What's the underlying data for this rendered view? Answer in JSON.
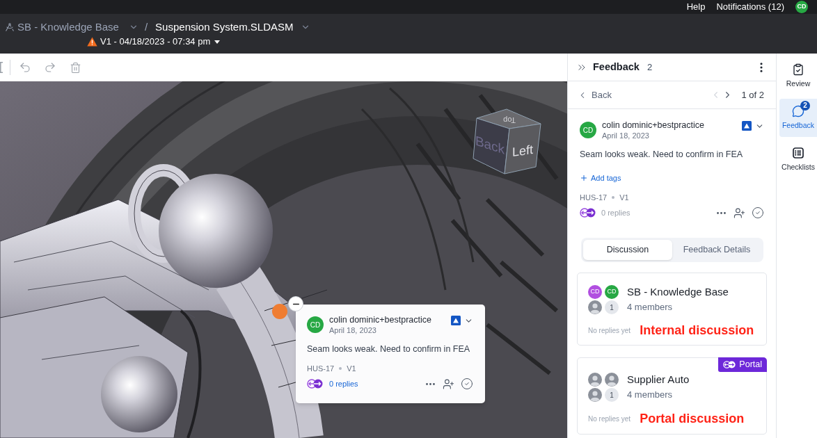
{
  "top_bar": {
    "links": [
      "Help",
      "Notifications (12)"
    ],
    "user_initials": "CD"
  },
  "header": {
    "project": "SB - Knowledge Base",
    "separator": "/",
    "file": "Suspension System.SLDASM",
    "version": "V1 - 04/18/2023 - 07:34 pm"
  },
  "viewport": {
    "view_cube": {
      "faces": [
        {
          "kind": "top",
          "label": "Top"
        },
        {
          "kind": "back",
          "label": "Back"
        },
        {
          "kind": "left",
          "label": "Left"
        }
      ]
    },
    "popup": {
      "initials": "CD",
      "author": "colin dominic+bestpractice",
      "date": "April 18, 2023",
      "text": "Seam looks weak. Need to confirm in FEA",
      "id": "HUS-17",
      "version": "V1",
      "replies": "0 replies"
    }
  },
  "feedback_panel": {
    "title": "Feedback",
    "count": "2",
    "back": "Back",
    "pager": {
      "text": "1 of 2",
      "prev_disabled": true,
      "next_disabled": false
    },
    "comment": {
      "initials": "CD",
      "author": "colin dominic+bestpractice",
      "date": "April 18, 2023",
      "text": "Seam looks weak. Need to confirm in FEA",
      "add_tags": "Add tags",
      "id": "HUS-17",
      "version": "V1",
      "replies": "0 replies"
    },
    "tabs": [
      {
        "label": "Discussion",
        "selected": true
      },
      {
        "label": "Feedback Details",
        "selected": false
      }
    ],
    "discussions": [
      {
        "name": "SB - Knowledge Base",
        "avatars": [
          {
            "kind": "initials",
            "text": "CD",
            "color": "#b14fe0"
          },
          {
            "kind": "initials",
            "text": "CD",
            "color": "#27a844"
          },
          {
            "kind": "photo"
          },
          {
            "kind": "count",
            "text": "1"
          }
        ],
        "members": "4 members",
        "status": "No replies yet",
        "annotation": "Internal discussion"
      },
      {
        "name": "Supplier Auto",
        "badge": "Portal",
        "avatars": [
          {
            "kind": "photo"
          },
          {
            "kind": "photo"
          },
          {
            "kind": "photo"
          },
          {
            "kind": "count",
            "text": "1"
          }
        ],
        "members": "4 members",
        "status": "No replies yet",
        "annotation": "Portal discussion"
      }
    ]
  },
  "right_rail": {
    "items": [
      {
        "kind": "review",
        "label": "Review",
        "selected": false
      },
      {
        "kind": "feedback",
        "label": "Feedback",
        "selected": true,
        "badge": "2"
      },
      {
        "kind": "checklists",
        "label": "Checklists",
        "selected": false
      }
    ]
  }
}
